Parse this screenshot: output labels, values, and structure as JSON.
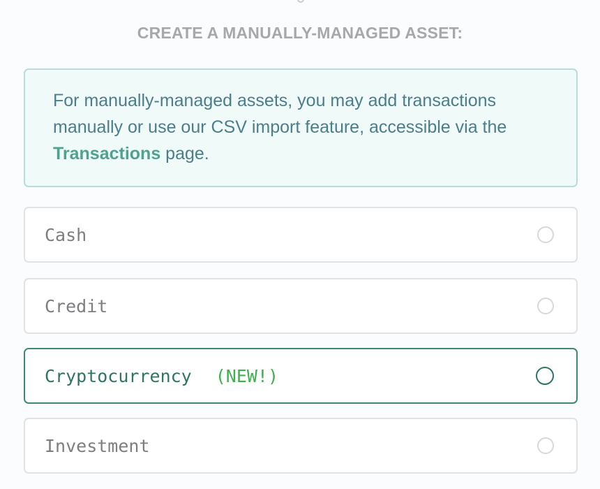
{
  "section": {
    "title": "CREATE A MANUALLY-MANAGED ASSET:"
  },
  "info": {
    "text_before": "For manually-managed assets, you may add transactions manually or use our CSV import feature, accessible via the ",
    "link": "Transactions",
    "text_after": " page."
  },
  "options": [
    {
      "label": "Cash",
      "badge": "",
      "selected": false
    },
    {
      "label": "Credit",
      "badge": "",
      "selected": false
    },
    {
      "label": "Cryptocurrency",
      "badge": "(NEW!)",
      "selected": false
    },
    {
      "label": "Investment",
      "badge": "",
      "selected": false
    }
  ],
  "colors": {
    "accent": "#3d8a73",
    "badge": "#3eb04f",
    "info_bg": "#effaf9"
  }
}
